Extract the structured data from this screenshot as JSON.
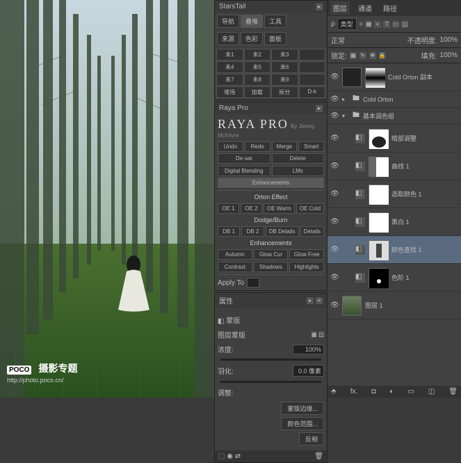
{
  "starsTail": {
    "title": "StarsTail",
    "tabs": [
      "导航",
      "叠堆",
      "工具"
    ],
    "row2": [
      "来源",
      "色彩",
      "面板"
    ],
    "grid": [
      "未1",
      "未2",
      "未3",
      "",
      "未4",
      "未5",
      "未6",
      "",
      "未7",
      "未8",
      "未9",
      "",
      "堆场",
      "加载",
      "拆分",
      "D-k"
    ]
  },
  "raya": {
    "title": "RAYA PRO",
    "by": "By Jimmy McIntyre",
    "top": [
      "Undo",
      "Redo",
      "Merge",
      "Smart",
      "De-sat",
      "Delete"
    ],
    "tabs": [
      "Digital Blending",
      "LMs",
      "Enhancements"
    ],
    "sec1": "Orton Effect",
    "orton": [
      "OE 1",
      "OE 2",
      "OE Warm",
      "OE Cold"
    ],
    "sec2": "Dodge/Burn",
    "db": [
      "DB 1",
      "DB 2",
      "DB Details",
      "Details"
    ],
    "sec3": "Enhancements",
    "enh1": [
      "Autumn",
      "Glow Cur",
      "Glow Free"
    ],
    "enh2": [
      "Contrast",
      "Shadows",
      "Highlights"
    ],
    "apply": "Apply To"
  },
  "props": {
    "title": "属性",
    "sub": "蒙版",
    "mask": "图层蒙版",
    "density": "浓度:",
    "densityVal": "100%",
    "feather": "羽化:",
    "featherVal": "0.0 像素",
    "adjust": "调整:",
    "btns": [
      "蒙版边缘...",
      "颜色范围...",
      "反相"
    ]
  },
  "right": {
    "tabs": [
      "图层",
      "通道",
      "路径"
    ],
    "kind": "类型",
    "mode": "正常",
    "opacity": "不透明度:",
    "opacityVal": "100%",
    "lock": "锁定:",
    "fill": "填充:",
    "fillVal": "100%"
  },
  "layers": [
    {
      "t": "l",
      "name": "Cold Orton 副本",
      "mask": "grad"
    },
    {
      "t": "g",
      "name": "Cold Orton",
      "open": false
    },
    {
      "t": "g",
      "name": "基本调色组",
      "open": true
    },
    {
      "t": "a",
      "name": "暗部调整",
      "mask": "dark"
    },
    {
      "t": "a",
      "name": "曲线 1",
      "mask": "curve"
    },
    {
      "t": "a",
      "name": "选取颜色 1",
      "mask": "white"
    },
    {
      "t": "a",
      "name": "黑白 1",
      "mask": "white"
    },
    {
      "t": "a",
      "name": "颜色查找 1",
      "mask": "noise",
      "sel": true
    },
    {
      "t": "a",
      "name": "色阶 1",
      "mask": "figure"
    },
    {
      "t": "i",
      "name": "图层 1"
    }
  ],
  "watermark": {
    "logo": "POCO",
    "sub": "摄影专题",
    "url": "http://photo.poco.cn/"
  }
}
